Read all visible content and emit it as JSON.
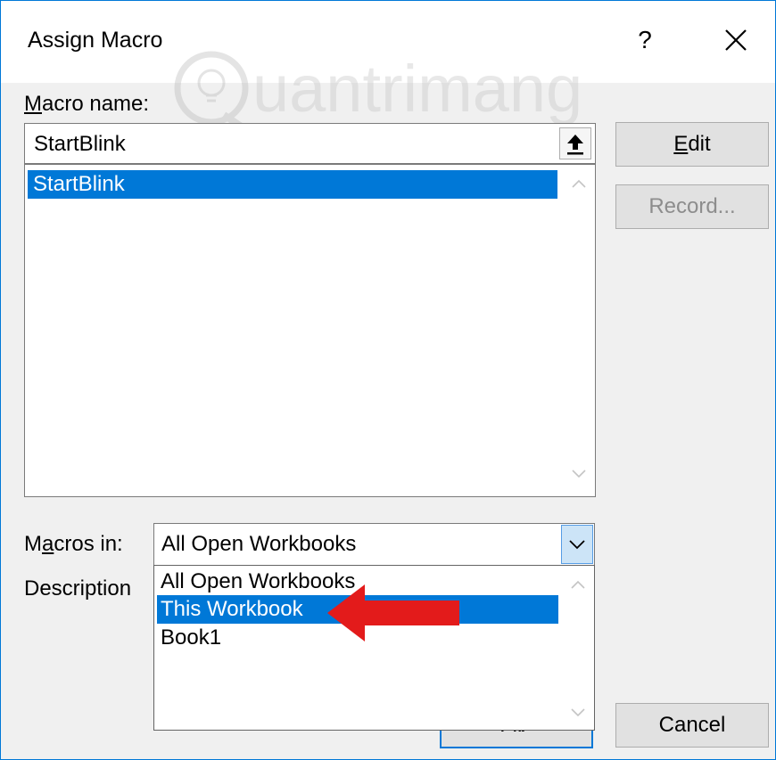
{
  "window": {
    "title": "Assign Macro",
    "help_label": "?"
  },
  "macro_name": {
    "label_u": "M",
    "label_rest": "acro name:",
    "value": "StartBlink"
  },
  "macro_list": {
    "items": [
      "StartBlink"
    ],
    "selected_index": 0
  },
  "buttons": {
    "edit_u": "E",
    "edit_rest": "dit",
    "record": "Record...",
    "ok": "OK",
    "cancel": "Cancel"
  },
  "macros_in": {
    "label_pre": "M",
    "label_u": "a",
    "label_rest": "cros in:",
    "value": "All Open Workbooks",
    "options": [
      "All Open Workbooks",
      "This Workbook",
      "Book1"
    ],
    "highlighted_index": 1
  },
  "description": {
    "label": "Description"
  },
  "watermark": {
    "text": "uantrimang"
  },
  "colors": {
    "accent": "#0078d7",
    "arrow": "#e31b1b",
    "selection": "#0078d7"
  },
  "icons": [
    "close-icon",
    "upload-arrow-icon",
    "scroll-up-icon",
    "scroll-down-icon",
    "dropdown-chevron-icon",
    "red-pointer-arrow"
  ]
}
